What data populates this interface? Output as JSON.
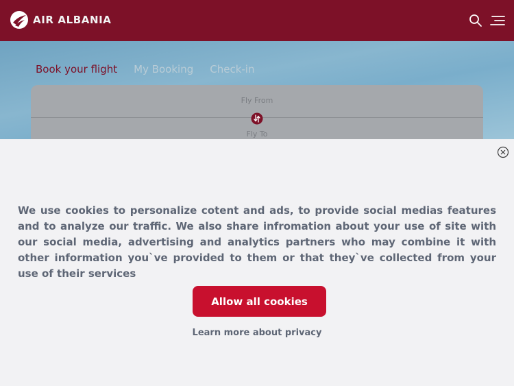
{
  "header": {
    "brand": "AIR ALBANIA",
    "logo_icon": "air-albania-logo-icon",
    "search_icon": "search-icon",
    "menu_icon": "menu-icon",
    "background_color": "#7d1128"
  },
  "booking": {
    "tabs": [
      {
        "label": "Book your flight",
        "active": true
      },
      {
        "label": "My Booking",
        "active": false
      },
      {
        "label": "Check-in",
        "active": false
      }
    ],
    "fly_from_label": "Fly From",
    "fly_to_label": "Fly To",
    "swap_icon": "swap-icon"
  },
  "cookie_banner": {
    "close_icon": "close-icon",
    "message": "We use cookies to personalize cotent and ads, to provide social medias features and to analyze our traffic. We also share infromation about your use of site with our social media, advertising and analytics partners who may combine it with other information you`ve provided to them or that they`ve collected from your use of their services",
    "allow_button_label": "Allow all cookies",
    "learn_more_label": "Learn more about privacy",
    "accent_color": "#c8102e"
  }
}
